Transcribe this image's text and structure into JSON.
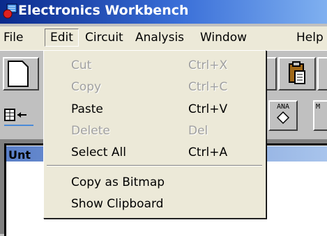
{
  "window": {
    "title": "Electronics Workbench"
  },
  "menubar": {
    "items": [
      {
        "label": "File"
      },
      {
        "label": "Edit"
      },
      {
        "label": "Circuit"
      },
      {
        "label": "Analysis"
      },
      {
        "label": "Window"
      },
      {
        "label": "Help"
      }
    ]
  },
  "edit_menu": {
    "items": [
      {
        "label": "Cut",
        "shortcut": "Ctrl+X",
        "enabled": false
      },
      {
        "label": "Copy",
        "shortcut": "Ctrl+C",
        "enabled": false
      },
      {
        "label": "Paste",
        "shortcut": "Ctrl+V",
        "enabled": true
      },
      {
        "label": "Delete",
        "shortcut": "Del",
        "enabled": false
      },
      {
        "label": "Select All",
        "shortcut": "Ctrl+A",
        "enabled": true
      },
      {
        "label": "Copy as Bitmap",
        "shortcut": "",
        "enabled": true
      },
      {
        "label": "Show Clipboard",
        "shortcut": "",
        "enabled": true
      }
    ]
  },
  "toolbar": {
    "parts_bin_1": "ANA",
    "parts_bin_2": "M"
  },
  "document": {
    "title_partial": "Unt"
  },
  "colors": {
    "title_bar": "#0a2a8c",
    "menu_bg": "#ece9d8",
    "disabled_text": "#a0a0a0"
  }
}
